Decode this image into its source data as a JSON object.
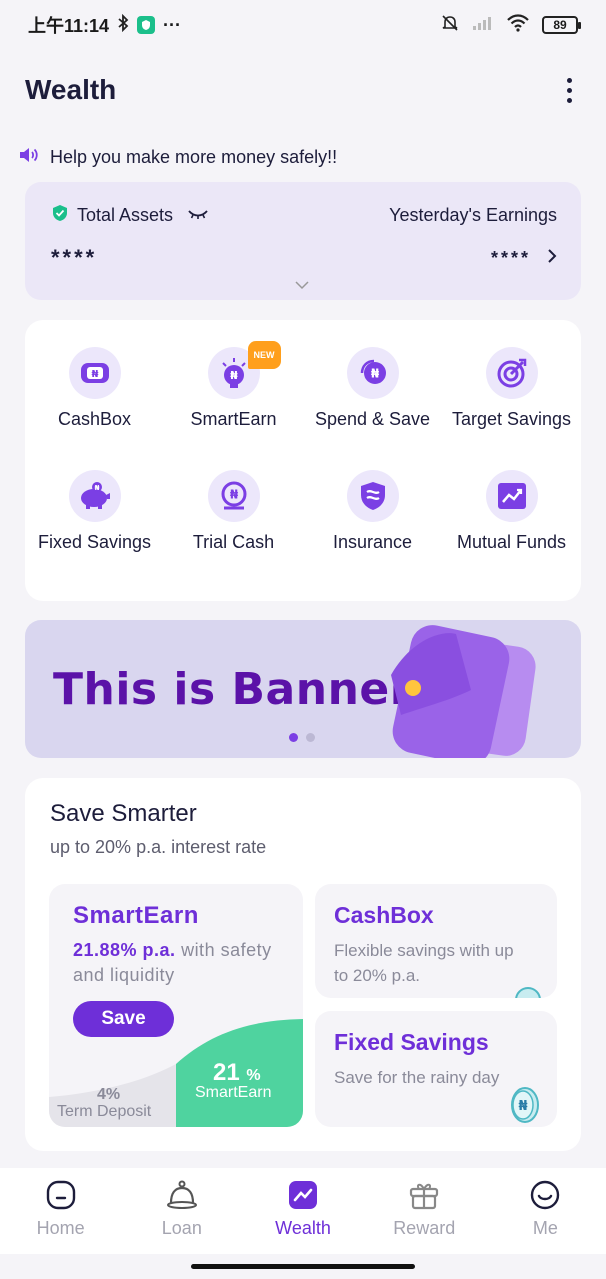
{
  "status_bar": {
    "time": "上午11:14",
    "more": "···",
    "battery": "89"
  },
  "header": {
    "title": "Wealth"
  },
  "notice": {
    "text": "Help you make more money safely!!"
  },
  "assets": {
    "total_label": "Total Assets",
    "earnings_label": "Yesterday's Earnings",
    "total_value": "****",
    "earnings_value": "****"
  },
  "services": [
    {
      "label": "CashBox",
      "icon": "cashbox-icon"
    },
    {
      "label": "SmartEarn",
      "icon": "smartearn-icon",
      "badge": "NEW"
    },
    {
      "label": "Spend & Save",
      "icon": "spend-save-icon"
    },
    {
      "label": "Target Savings",
      "icon": "target-icon"
    },
    {
      "label": "Fixed Savings",
      "icon": "piggy-bank-icon"
    },
    {
      "label": "Trial Cash",
      "icon": "trial-cash-icon"
    },
    {
      "label": "Insurance",
      "icon": "insurance-icon"
    },
    {
      "label": "Mutual Funds",
      "icon": "chart-icon"
    }
  ],
  "banner": {
    "text": "This is Banner",
    "slides": 2,
    "active_slide": 1
  },
  "save_smarter": {
    "title": "Save Smarter",
    "subtitle": "up to 20% p.a. interest rate",
    "smartearn": {
      "title": "SmartEarn",
      "rate": "21.88% p.a.",
      "desc_rest": " with safety and liquidity",
      "button": "Save",
      "term_pct": "4%",
      "term_label": "Term Deposit",
      "se_pct": "21",
      "se_pct_unit": "%",
      "se_label": "SmartEarn"
    },
    "cashbox": {
      "title": "CashBox",
      "desc": "Flexible savings with up to 20% p.a."
    },
    "fixed": {
      "title": "Fixed Savings",
      "desc": "Save for the rainy day"
    }
  },
  "bottom_nav": [
    {
      "label": "Home",
      "icon": "home-icon",
      "active": false
    },
    {
      "label": "Loan",
      "icon": "loan-icon",
      "active": false
    },
    {
      "label": "Wealth",
      "icon": "wealth-icon",
      "active": true
    },
    {
      "label": "Reward",
      "icon": "gift-icon",
      "active": false
    },
    {
      "label": "Me",
      "icon": "smiley-icon",
      "active": false
    }
  ],
  "colors": {
    "accent": "#6e2fd8",
    "green": "#4fd39f",
    "banner_bg": "#d9d6ef",
    "banner_text": "#5b12a8"
  }
}
